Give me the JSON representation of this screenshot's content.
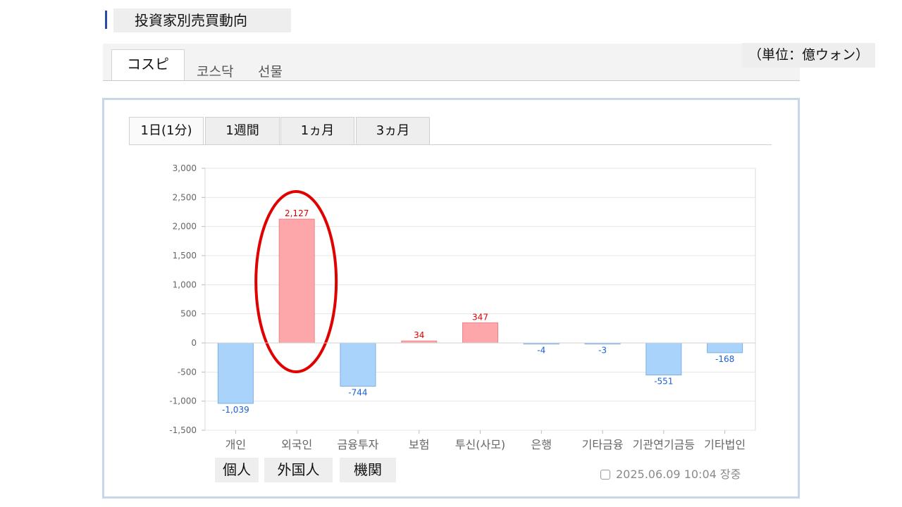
{
  "header": {
    "title": "投資家別売買動向"
  },
  "market_tabs": [
    {
      "label": "コスピ",
      "active": true
    },
    {
      "label": "코스닥",
      "active": false
    },
    {
      "label": "선물",
      "active": false
    }
  ],
  "unit": "（単位：億ウォン）",
  "period_tabs": [
    {
      "label": "1日(1分)",
      "active": true
    },
    {
      "label": "1週間",
      "active": false
    },
    {
      "label": "1ヵ月",
      "active": false
    },
    {
      "label": "3ヵ月",
      "active": false
    }
  ],
  "jp_labels": [
    "個人",
    "外国人",
    "機関"
  ],
  "timestamp": "2025.06.09 10:04 장중",
  "colors": {
    "positive_fill": "#fda7ab",
    "positive_stroke": "#f18489",
    "positive_label": "#e00000",
    "negative_fill": "#aad3fb",
    "negative_stroke": "#7cb1e6",
    "negative_label": "#1a5fd6",
    "highlight": "#e00000"
  },
  "chart_data": {
    "type": "bar",
    "categories": [
      "개인",
      "외국인",
      "금융투자",
      "보험",
      "투신(사모)",
      "은행",
      "기타금융",
      "기관연기금등",
      "기타법인"
    ],
    "values": [
      -1039,
      2127,
      -744,
      34,
      347,
      -4,
      -3,
      -551,
      -168
    ],
    "data_labels": [
      "-1,039",
      "2,127",
      "-744",
      "34",
      "347",
      "-4",
      "-3",
      "-551",
      "-168"
    ],
    "y_ticks": [
      "3,000",
      "2,500",
      "2,000",
      "1,500",
      "1,000",
      "500",
      "0",
      "-500",
      "-1,000",
      "-1,500"
    ],
    "ylim": [
      -1500,
      3000
    ],
    "grid": true,
    "highlight_category": "외국인"
  }
}
